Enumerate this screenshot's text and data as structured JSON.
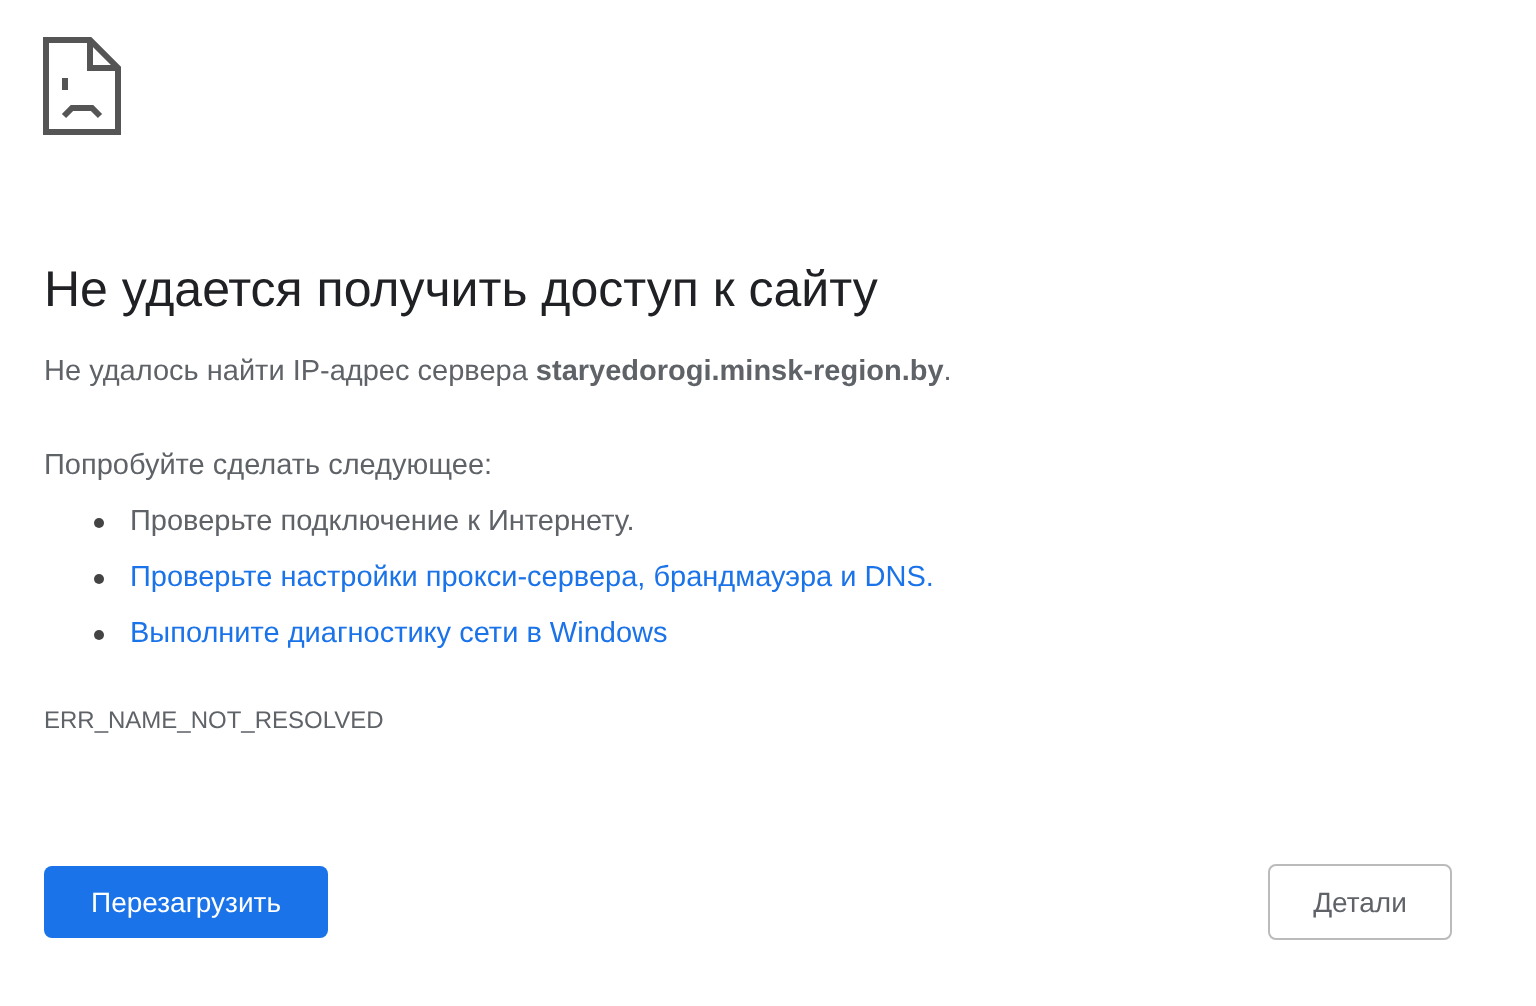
{
  "title": "Не удается получить доступ к сайту",
  "message": "Не удалось найти IP-адрес сервера **staryedorogi.minsk-region.by**.",
  "suggestions_heading": "Попробуйте сделать следующее:",
  "suggestions": [
    {
      "kind": "text",
      "text": "Проверьте подключение к Интернету."
    },
    {
      "kind": "link",
      "text": "Проверьте настройки прокси-сервера, брандмауэра и DNS."
    },
    {
      "kind": "link",
      "text": "Выполните диагностику сети в Windows"
    }
  ],
  "error_code": "ERR_NAME_NOT_RESOLVED",
  "buttons": {
    "reload": "Перезагрузить",
    "details": "Детали"
  }
}
